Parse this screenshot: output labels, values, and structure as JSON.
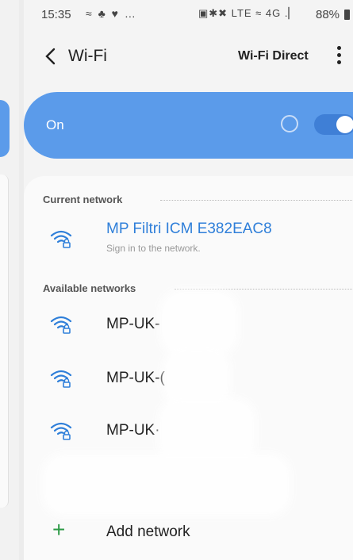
{
  "status_bar": {
    "time": "15:35",
    "left_icons": "≈ ♣ ♥ …",
    "right_icons": "▣✱✖ LTE ≈ 4G .▏",
    "battery": "88%"
  },
  "header": {
    "title": "Wi-Fi",
    "wifi_direct_label": "Wi-Fi Direct",
    "back_icon": "chevron-left-icon",
    "more_icon": "more-vertical-icon"
  },
  "wifi_toggle": {
    "label": "On",
    "state": "on"
  },
  "current_network": {
    "section_title": "Current network",
    "name": "MP Filtri ICM E382EAC8",
    "subtitle": "Sign in to the network."
  },
  "available_networks": {
    "section_title": "Available networks",
    "items": [
      {
        "name": "MP-UK-"
      },
      {
        "name": "MP-UK-("
      },
      {
        "name": "MP-UK·"
      }
    ]
  },
  "add_network": {
    "label": "Add network"
  },
  "colors": {
    "accent_blue": "#5b9bea",
    "toggle_blue": "#3f7fd6",
    "current_network_text": "#2f7fd9",
    "add_green": "#2e9b47"
  }
}
